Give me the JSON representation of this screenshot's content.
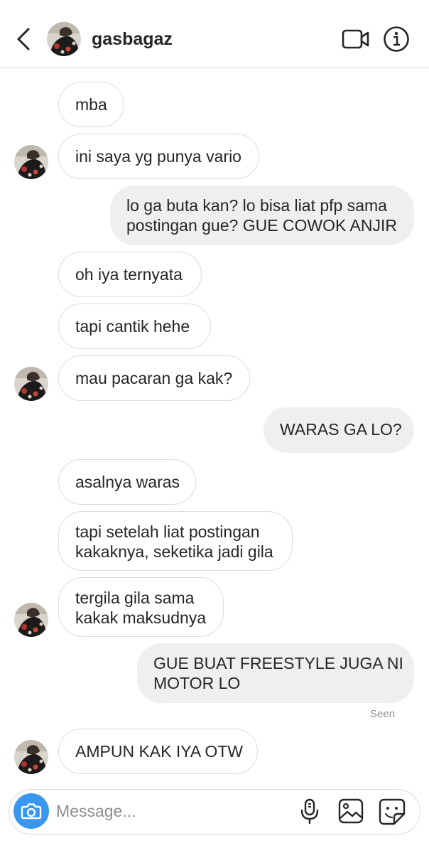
{
  "header": {
    "username": "gasbagaz",
    "icons": [
      "chevron-left-icon",
      "video-camera-icon",
      "info-icon"
    ]
  },
  "messages": [
    {
      "side": "in",
      "lines": [
        "mba"
      ],
      "avatar": false
    },
    {
      "side": "in",
      "lines": [
        "ini saya yg punya vario"
      ],
      "avatar": true
    },
    {
      "side": "out",
      "lines": [
        "lo ga buta kan? lo bisa liat pfp sama",
        "postingan gue? GUE COWOK ANJIR"
      ]
    },
    {
      "side": "in",
      "lines": [
        "oh iya ternyata"
      ],
      "avatar": false
    },
    {
      "side": "in",
      "lines": [
        "tapi cantik hehe"
      ],
      "avatar": false
    },
    {
      "side": "in",
      "lines": [
        "mau pacaran ga kak?"
      ],
      "avatar": true
    },
    {
      "side": "out",
      "lines": [
        "WARAS GA LO?"
      ]
    },
    {
      "side": "in",
      "lines": [
        "asalnya waras"
      ],
      "avatar": false
    },
    {
      "side": "in",
      "lines": [
        "tapi setelah liat postingan",
        "kakaknya, seketika jadi gila"
      ],
      "avatar": false
    },
    {
      "side": "in",
      "lines": [
        "tergila gila sama",
        "kakak maksudnya"
      ],
      "avatar": true
    },
    {
      "side": "out",
      "lines": [
        "GUE BUAT FREESTYLE JUGA NI",
        "MOTOR LO"
      ]
    },
    {
      "side": "in",
      "lines": [
        "AMPUN KAK IYA OTW"
      ],
      "avatar": true
    }
  ],
  "seen_label": "Seen",
  "composer": {
    "placeholder": "Message...",
    "icons": [
      "camera-icon",
      "microphone-icon",
      "gallery-icon",
      "sticker-icon"
    ]
  },
  "colors": {
    "accent": "#3897f0",
    "outgoing_bubble": "#efefef",
    "incoming_border": "#dcdcdc",
    "text": "#262626",
    "muted": "#8e8e8e"
  }
}
